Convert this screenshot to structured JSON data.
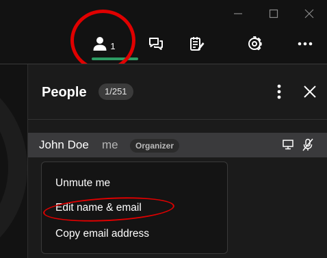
{
  "window": {
    "minimize_icon": "minimize-icon",
    "maximize_icon": "maximize-icon",
    "close_icon": "close-icon"
  },
  "toolbar": {
    "people_count": "1",
    "people_icon": "person-icon",
    "chat_icon": "chat-icon",
    "notes_icon": "notes-icon",
    "settings_icon": "gear-icon",
    "more_icon": "more-horizontal-icon",
    "active_underline_color": "#2e9c64"
  },
  "panel": {
    "title": "People",
    "count_badge": "1/251",
    "menu_icon": "more-vertical-icon",
    "close_icon": "close-icon"
  },
  "participant": {
    "name": "John Doe",
    "me_label": "me",
    "role": "Organizer",
    "screen_icon": "screen-share-icon",
    "mic_icon": "mic-muted-icon"
  },
  "context_menu": {
    "items": [
      {
        "label": "Unmute me"
      },
      {
        "label": "Edit name & email"
      },
      {
        "label": "Copy email address"
      }
    ]
  },
  "annotations": {
    "highlight_color": "#e00000"
  }
}
